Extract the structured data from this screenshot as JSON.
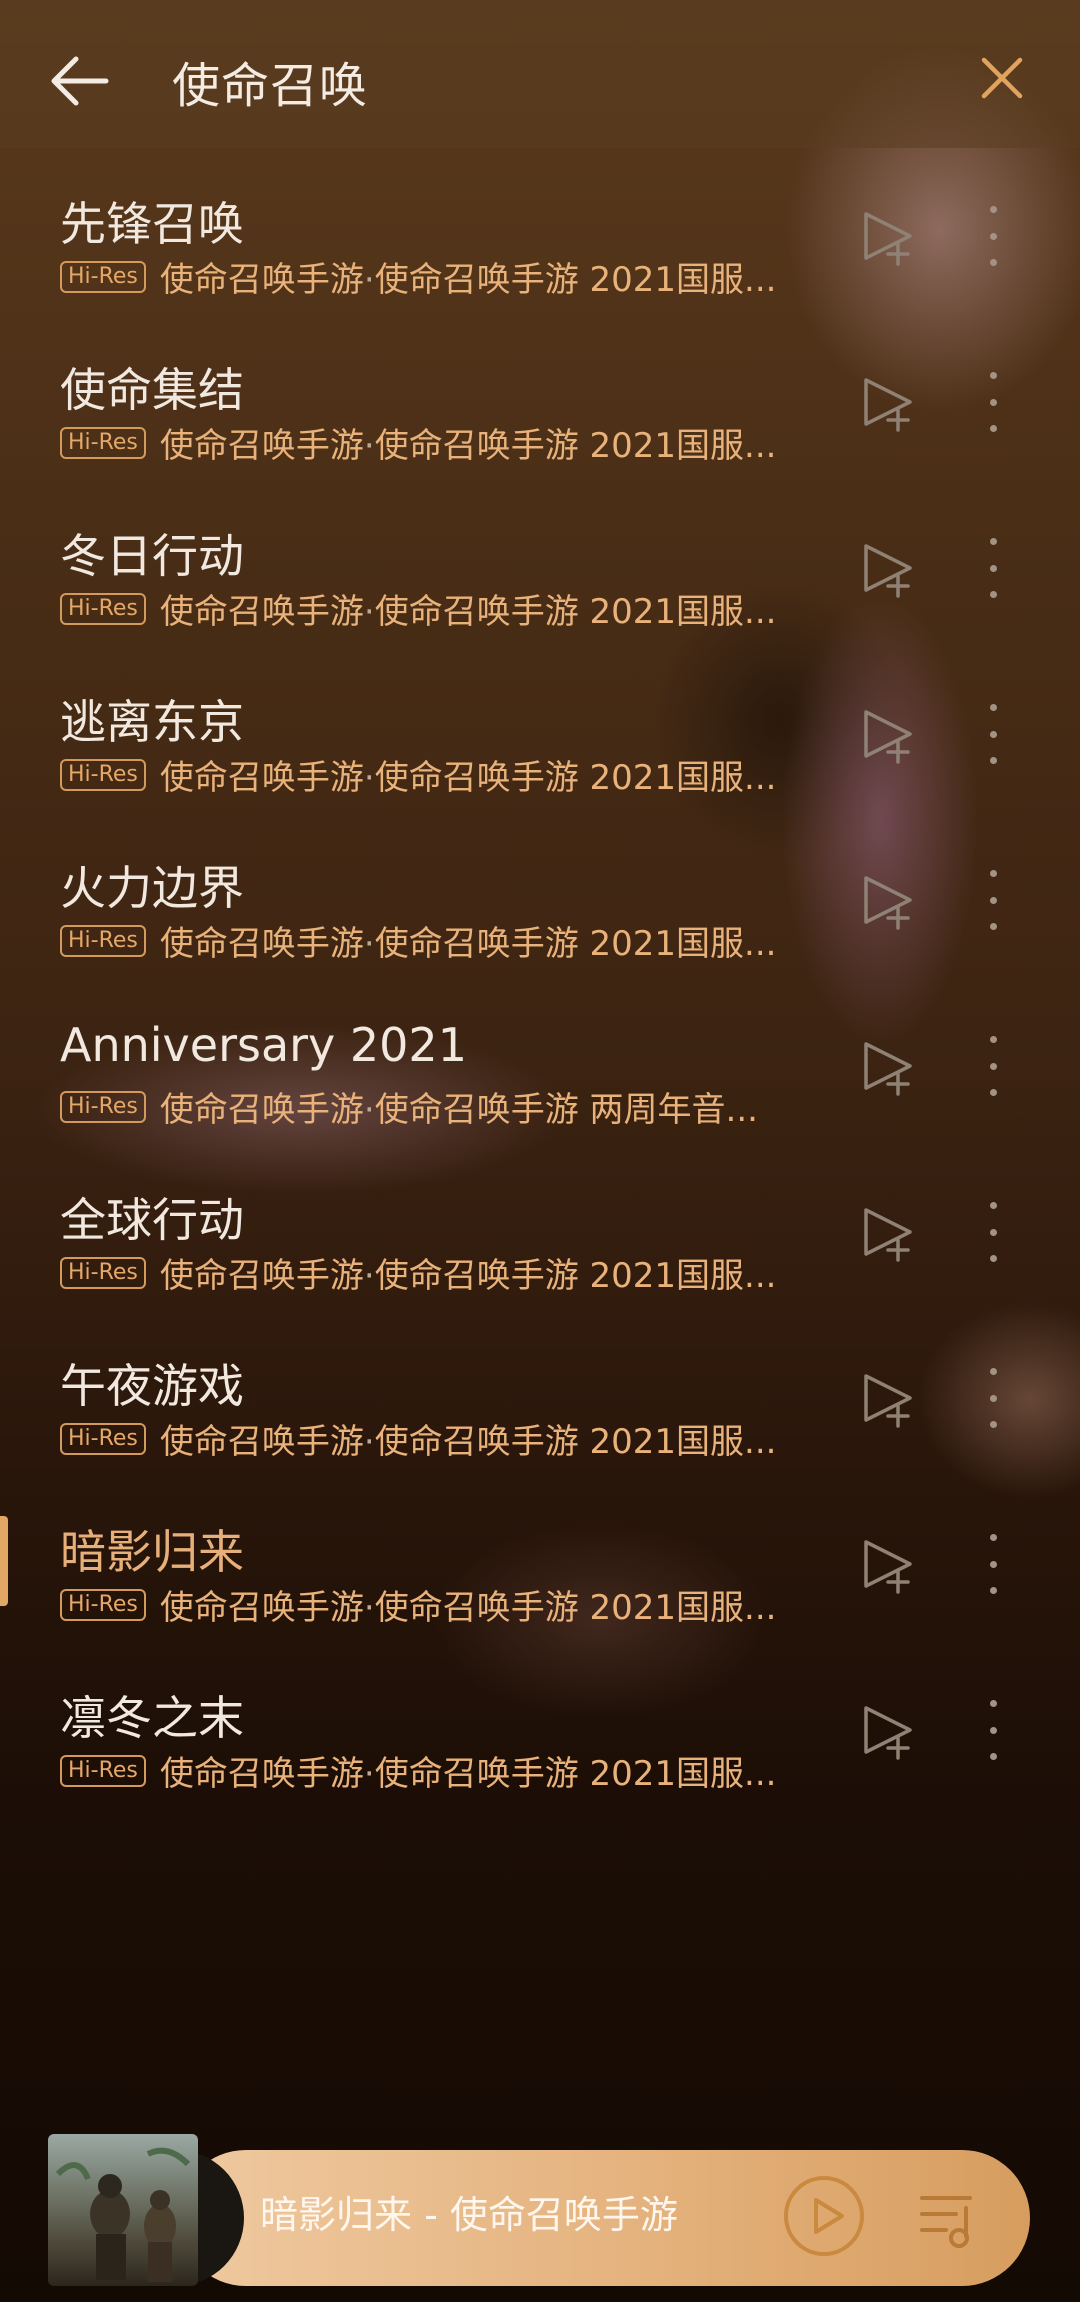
{
  "header": {
    "title": "使命召唤"
  },
  "badge_label": "Hi-Res",
  "songs": [
    {
      "title": "先锋召唤",
      "artist": "使命召唤手游",
      "sep": "·",
      "album": "使命召唤手游 2021国服..."
    },
    {
      "title": "使命集结",
      "artist": "使命召唤手游",
      "sep": "·",
      "album": "使命召唤手游 2021国服..."
    },
    {
      "title": "冬日行动",
      "artist": "使命召唤手游",
      "sep": "·",
      "album": "使命召唤手游 2021国服..."
    },
    {
      "title": "逃离东京",
      "artist": "使命召唤手游",
      "sep": "·",
      "album": "使命召唤手游 2021国服..."
    },
    {
      "title": "火力边界",
      "artist": "使命召唤手游",
      "sep": "·",
      "album": "使命召唤手游 2021国服..."
    },
    {
      "title": "Anniversary 2021",
      "artist": "使命召唤手游",
      "sep": "·",
      "album": "使命召唤手游 两周年音..."
    },
    {
      "title": "全球行动",
      "artist": "使命召唤手游",
      "sep": "·",
      "album": "使命召唤手游 2021国服..."
    },
    {
      "title": "午夜游戏",
      "artist": "使命召唤手游",
      "sep": "·",
      "album": "使命召唤手游 2021国服..."
    },
    {
      "title": "暗影归来",
      "artist": "使命召唤手游",
      "sep": "·",
      "album": "使命召唤手游 2021国服..."
    },
    {
      "title": "凛冬之末",
      "artist": "使命召唤手游",
      "sep": "·",
      "album": "使命召唤手游 2021国服..."
    }
  ],
  "now_playing": {
    "text": "暗影归来 - 使命召唤手游",
    "index": 8
  },
  "colors": {
    "accent": "#e3a765",
    "text": "#f1e8df",
    "subtext": "#bda894"
  },
  "icons": [
    "back-arrow-icon",
    "close-icon",
    "add-to-playlist-icon",
    "more-vertical-icon",
    "play-icon",
    "playlist-queue-icon"
  ]
}
